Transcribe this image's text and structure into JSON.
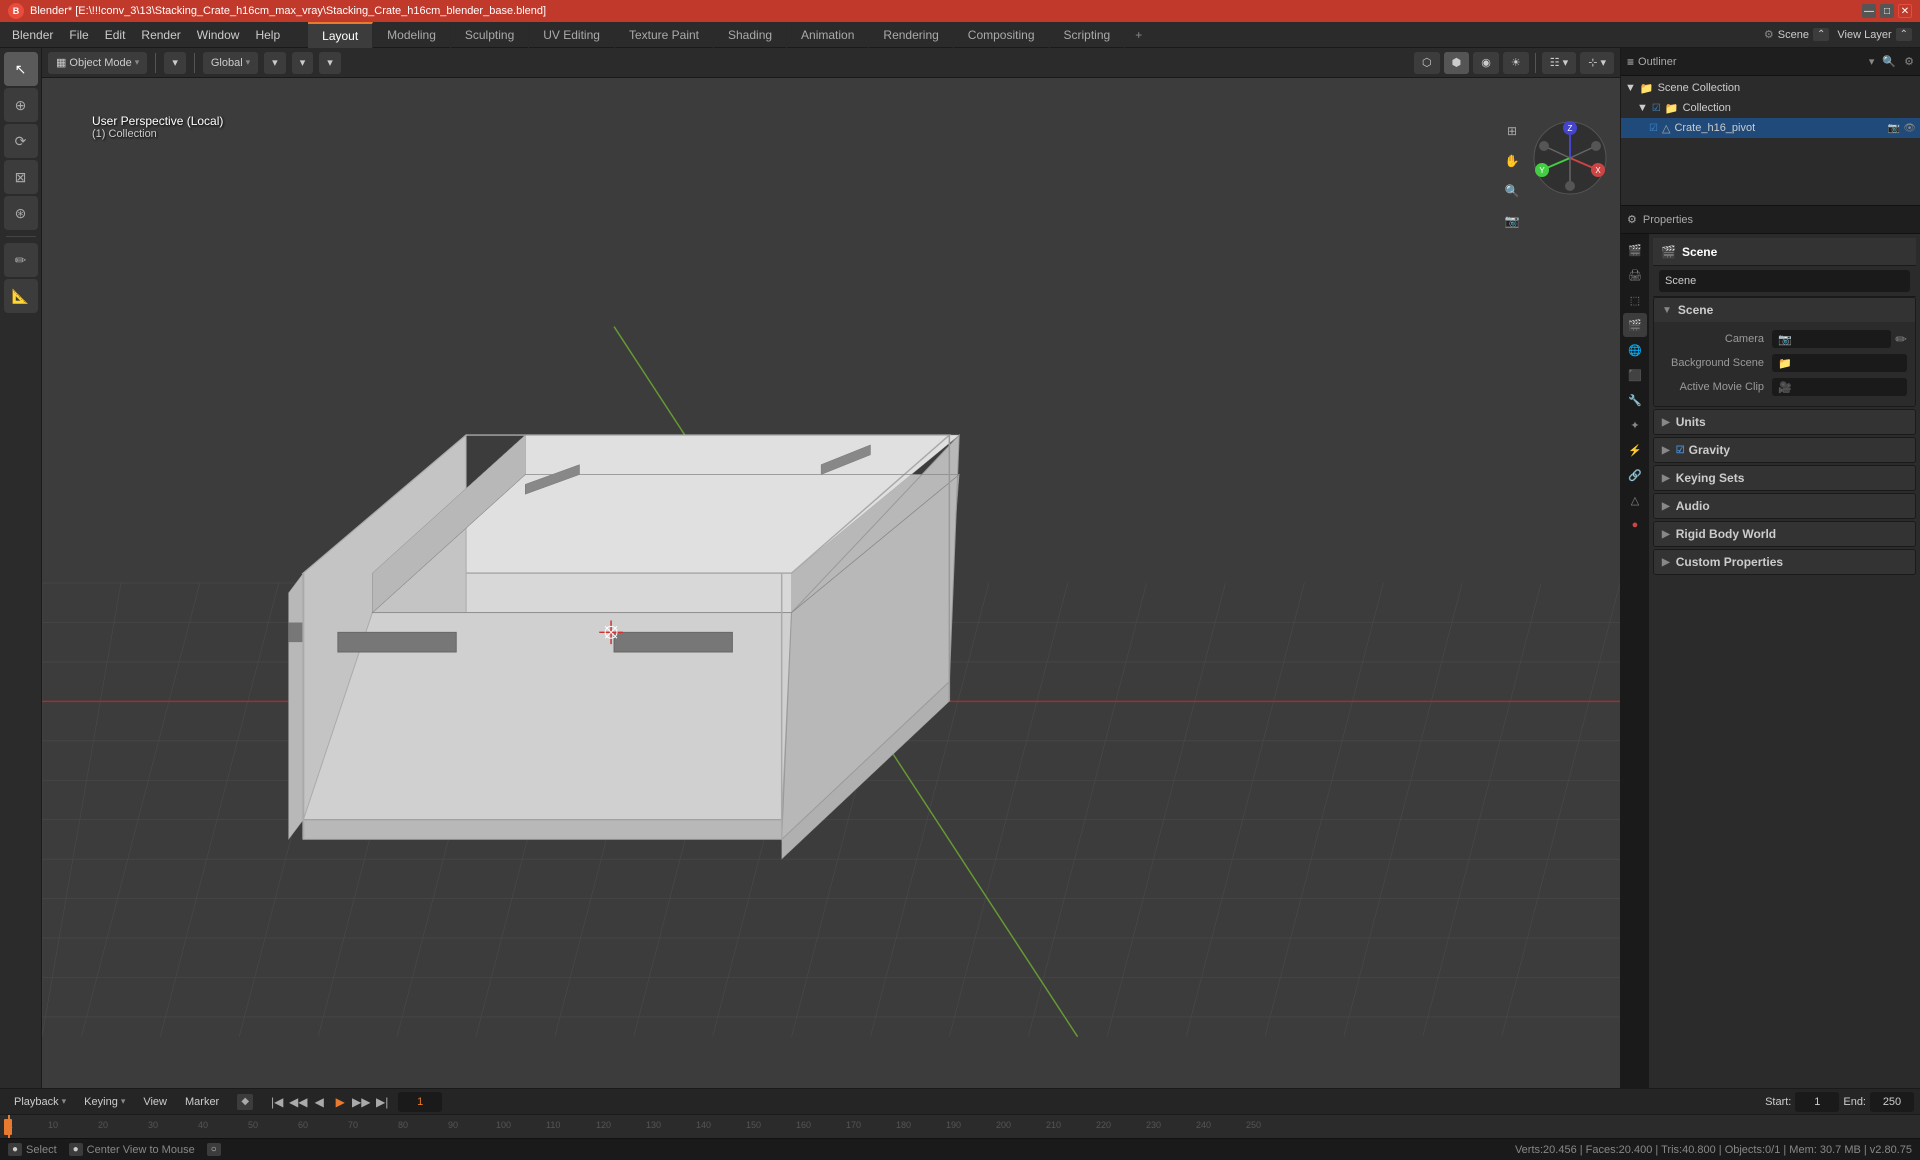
{
  "titlebar": {
    "title": "Blender* [E:\\!!!conv_3\\13\\Stacking_Crate_h16cm_max_vray\\Stacking_Crate_h16cm_blender_base.blend]",
    "logo": "B"
  },
  "menubar": {
    "items": [
      "Blender",
      "File",
      "Edit",
      "Render",
      "Window",
      "Help"
    ]
  },
  "workspace_tabs": {
    "tabs": [
      "Layout",
      "Modeling",
      "Sculpting",
      "UV Editing",
      "Texture Paint",
      "Shading",
      "Animation",
      "Rendering",
      "Compositing",
      "Scripting"
    ],
    "active": "Layout",
    "add_label": "+"
  },
  "viewport": {
    "mode_label": "Object Mode",
    "view_label": "User Perspective (Local)",
    "collection_label": "(1) Collection",
    "global_label": "Global",
    "header_buttons": [
      "Object Mode ▾",
      "▾",
      "Global ▾",
      "▾",
      "▾",
      "▾",
      "▾"
    ]
  },
  "tools": {
    "left": [
      "↕",
      "↔",
      "⟳",
      "⊕",
      "⊖",
      "✏",
      "⊘"
    ],
    "active": 0
  },
  "nav_gizmo": {
    "x_label": "X",
    "y_label": "Y",
    "z_label": "Z"
  },
  "outliner": {
    "title": "Outliner",
    "items": [
      {
        "label": "Scene Collection",
        "indent": 0,
        "icon": "📁",
        "type": "scene_collection"
      },
      {
        "label": "Collection",
        "indent": 1,
        "icon": "📁",
        "type": "collection",
        "selected": false
      },
      {
        "label": "Crate_h16_pivot",
        "indent": 2,
        "icon": "△",
        "type": "object",
        "selected": true
      }
    ]
  },
  "properties": {
    "active_tab": "scene",
    "tabs": [
      "render",
      "output",
      "view_layer",
      "scene",
      "world",
      "object",
      "modifier",
      "particles",
      "physics",
      "constraints",
      "object_data",
      "material"
    ],
    "scene_title": "Scene",
    "scene_name": "Scene",
    "sections": [
      {
        "id": "scene",
        "label": "Scene",
        "expanded": true,
        "rows": [
          {
            "label": "Camera",
            "value": ""
          },
          {
            "label": "Background Scene",
            "value": ""
          },
          {
            "label": "Active Movie Clip",
            "value": ""
          }
        ]
      },
      {
        "id": "units",
        "label": "Units",
        "expanded": false,
        "rows": []
      },
      {
        "id": "gravity",
        "label": "Gravity",
        "expanded": false,
        "rows": [],
        "has_checkbox": true
      },
      {
        "id": "keying_sets",
        "label": "Keying Sets",
        "expanded": false,
        "rows": []
      },
      {
        "id": "audio",
        "label": "Audio",
        "expanded": false,
        "rows": []
      },
      {
        "id": "rigid_body_world",
        "label": "Rigid Body World",
        "expanded": false,
        "rows": []
      },
      {
        "id": "custom_properties",
        "label": "Custom Properties",
        "expanded": false,
        "rows": []
      }
    ]
  },
  "timeline": {
    "playback_label": "Playback",
    "keying_label": "Keying",
    "view_label": "View",
    "marker_label": "Marker",
    "current_frame": "1",
    "start_frame": "1",
    "end_frame": "250",
    "start_label": "Start:",
    "end_label": "End:",
    "tick_labels": [
      "1",
      "10",
      "20",
      "30",
      "40",
      "50",
      "60",
      "70",
      "80",
      "90",
      "100",
      "110",
      "120",
      "130",
      "140",
      "150",
      "160",
      "170",
      "180",
      "190",
      "200",
      "210",
      "220",
      "230",
      "240",
      "250"
    ]
  },
  "statusbar": {
    "select_label": "Select",
    "center_view_label": "Center View to Mouse",
    "collection_info": "Collection",
    "stats": "Verts:20.456 | Faces:20.400 | Tris:40.800 | Objects:0/1 | Mem: 30.7 MB | v2.80.75"
  },
  "header_right": {
    "scene_label": "Scene",
    "view_layer_label": "View Layer"
  },
  "colors": {
    "accent": "#e87a2f",
    "active_tab_border": "#e87a2f",
    "bg_dark": "#1a1a1a",
    "bg_mid": "#2b2b2b",
    "bg_light": "#3c3c3c",
    "text_light": "#cccccc",
    "selected": "#1f4a7a",
    "axis_x": "#cc3333",
    "axis_y": "#33cc33",
    "axis_z": "#3333cc"
  }
}
